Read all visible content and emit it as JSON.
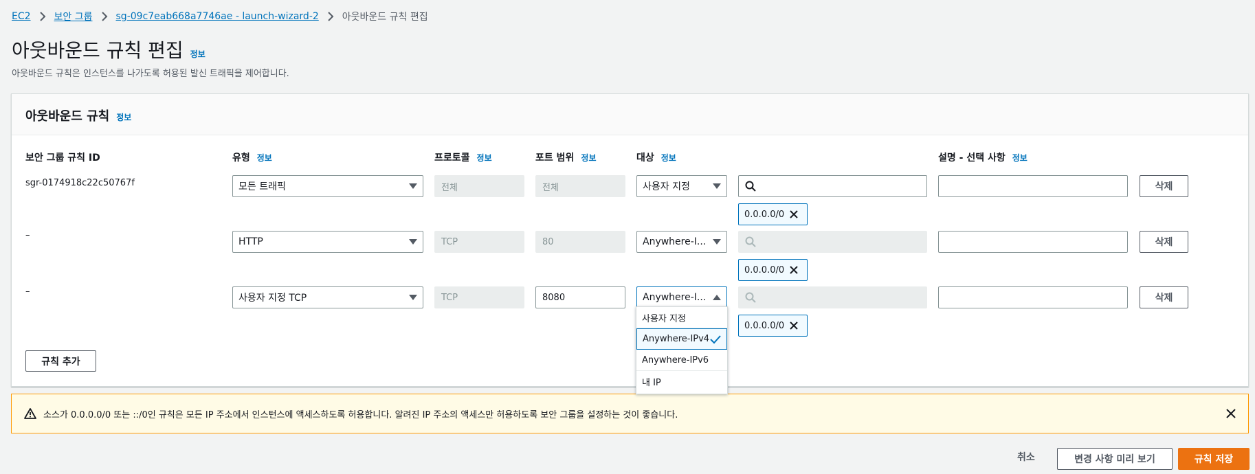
{
  "breadcrumb": {
    "items": [
      "EC2",
      "보안 그룹",
      "sg-09c7eab668a7746ae - launch-wizard-2"
    ],
    "current": "아웃바운드 규칙 편집"
  },
  "page": {
    "title": "아웃바운드 규칙 편집",
    "info": "정보",
    "description": "아웃바운드 규칙은 인스턴스를 나가도록 허용된 발신 트래픽을 제어합니다."
  },
  "panel": {
    "title": "아웃바운드 규칙",
    "info": "정보",
    "columns": {
      "rule_id": "보안 그룹 규칙 ID",
      "type": "유형",
      "protocol": "프로토콜",
      "port_range": "포트 범위",
      "destination": "대상",
      "description": "설명 - 선택 사항",
      "info": "정보"
    },
    "rows": [
      {
        "rule_id": "sgr-0174918c22c50767f",
        "type": "모든 트래픽",
        "protocol": "전체",
        "port": "전체",
        "destination": "사용자 지정",
        "token": "0.0.0.0/0",
        "delete": "삭제"
      },
      {
        "rule_id": "–",
        "type": "HTTP",
        "protocol": "TCP",
        "port": "80",
        "destination": "Anywhere-I...",
        "token": "0.0.0.0/0",
        "delete": "삭제"
      },
      {
        "rule_id": "–",
        "type": "사용자 지정 TCP",
        "protocol": "TCP",
        "port": "8080",
        "destination": "Anywhere-I...",
        "token": "0.0.0.0/0",
        "delete": "삭제"
      }
    ],
    "add_rule": "규칙 추가",
    "dropdown_options": [
      "사용자 지정",
      "Anywhere-IPv4",
      "Anywhere-IPv6",
      "내 IP"
    ]
  },
  "alert": {
    "text": "소스가 0.0.0.0/0 또는 ::/0인 규칙은 모든 IP 주소에서 인스턴스에 액세스하도록 허용합니다. 알려진 IP 주소의 액세스만 허용하도록 보안 그룹을 설정하는 것이 좋습니다."
  },
  "footer": {
    "cancel": "취소",
    "preview": "변경 사항 미리 보기",
    "save": "규칙 저장"
  },
  "colors": {
    "link": "#0073bb",
    "primary": "#ec7211",
    "warning_border": "#ff9900",
    "warning_bg": "#fffbe6"
  }
}
